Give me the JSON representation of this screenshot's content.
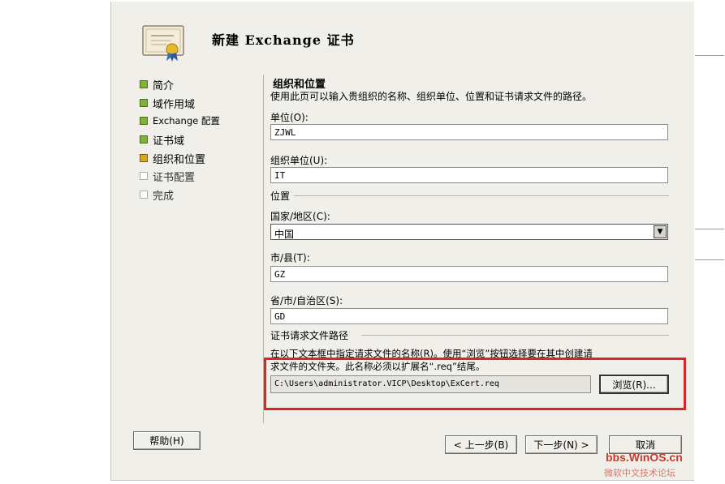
{
  "wizard": {
    "title": "新建 Exchange 证书"
  },
  "nav": {
    "items": [
      {
        "label": "简介",
        "state": "done"
      },
      {
        "label": "域作用域",
        "state": "done"
      },
      {
        "label": "Exchange 配置",
        "state": "done"
      },
      {
        "label": "证书域",
        "state": "done"
      },
      {
        "label": "组织和位置",
        "state": "current"
      },
      {
        "label": "证书配置",
        "state": "pending"
      },
      {
        "label": "完成",
        "state": "pending"
      }
    ]
  },
  "page": {
    "heading": "组织和位置",
    "description": "使用此页可以输入贵组织的名称、组织单位、位置和证书请求文件的路径。",
    "org_label": "单位(O):",
    "org_value": "ZJWL",
    "unit_label": "组织单位(U):",
    "unit_value": "IT",
    "location_group": "位置",
    "country_label": "国家/地区(C):",
    "country_value": "中国",
    "city_label": "市/县(T):",
    "city_value": "GZ",
    "state_label": "省/市/自治区(S):",
    "state_value": "GD",
    "request_group": "证书请求文件路径",
    "request_desc_line1": "在以下文本框中指定请求文件的名称(R)。使用“浏览”按钮选择要在其中创建请",
    "request_desc_line2": "求文件的文件夹。此名称必须以扩展名“.req”结尾。",
    "request_path": "C:\\Users\\administrator.VICP\\Desktop\\ExCert.req",
    "browse_label": "浏览(R)..."
  },
  "footer": {
    "help_label": "帮助(H)",
    "back_label": "< 上一步(B)",
    "next_label": "下一步(N) >",
    "cancel_label": "取消"
  },
  "watermark": {
    "site": "bbs.WinOS.cn",
    "name": "微软中文技术论坛"
  },
  "colors": {
    "nav_done": "#7fb338",
    "nav_current": "#d6a81f",
    "highlight_box": "#e22121"
  }
}
